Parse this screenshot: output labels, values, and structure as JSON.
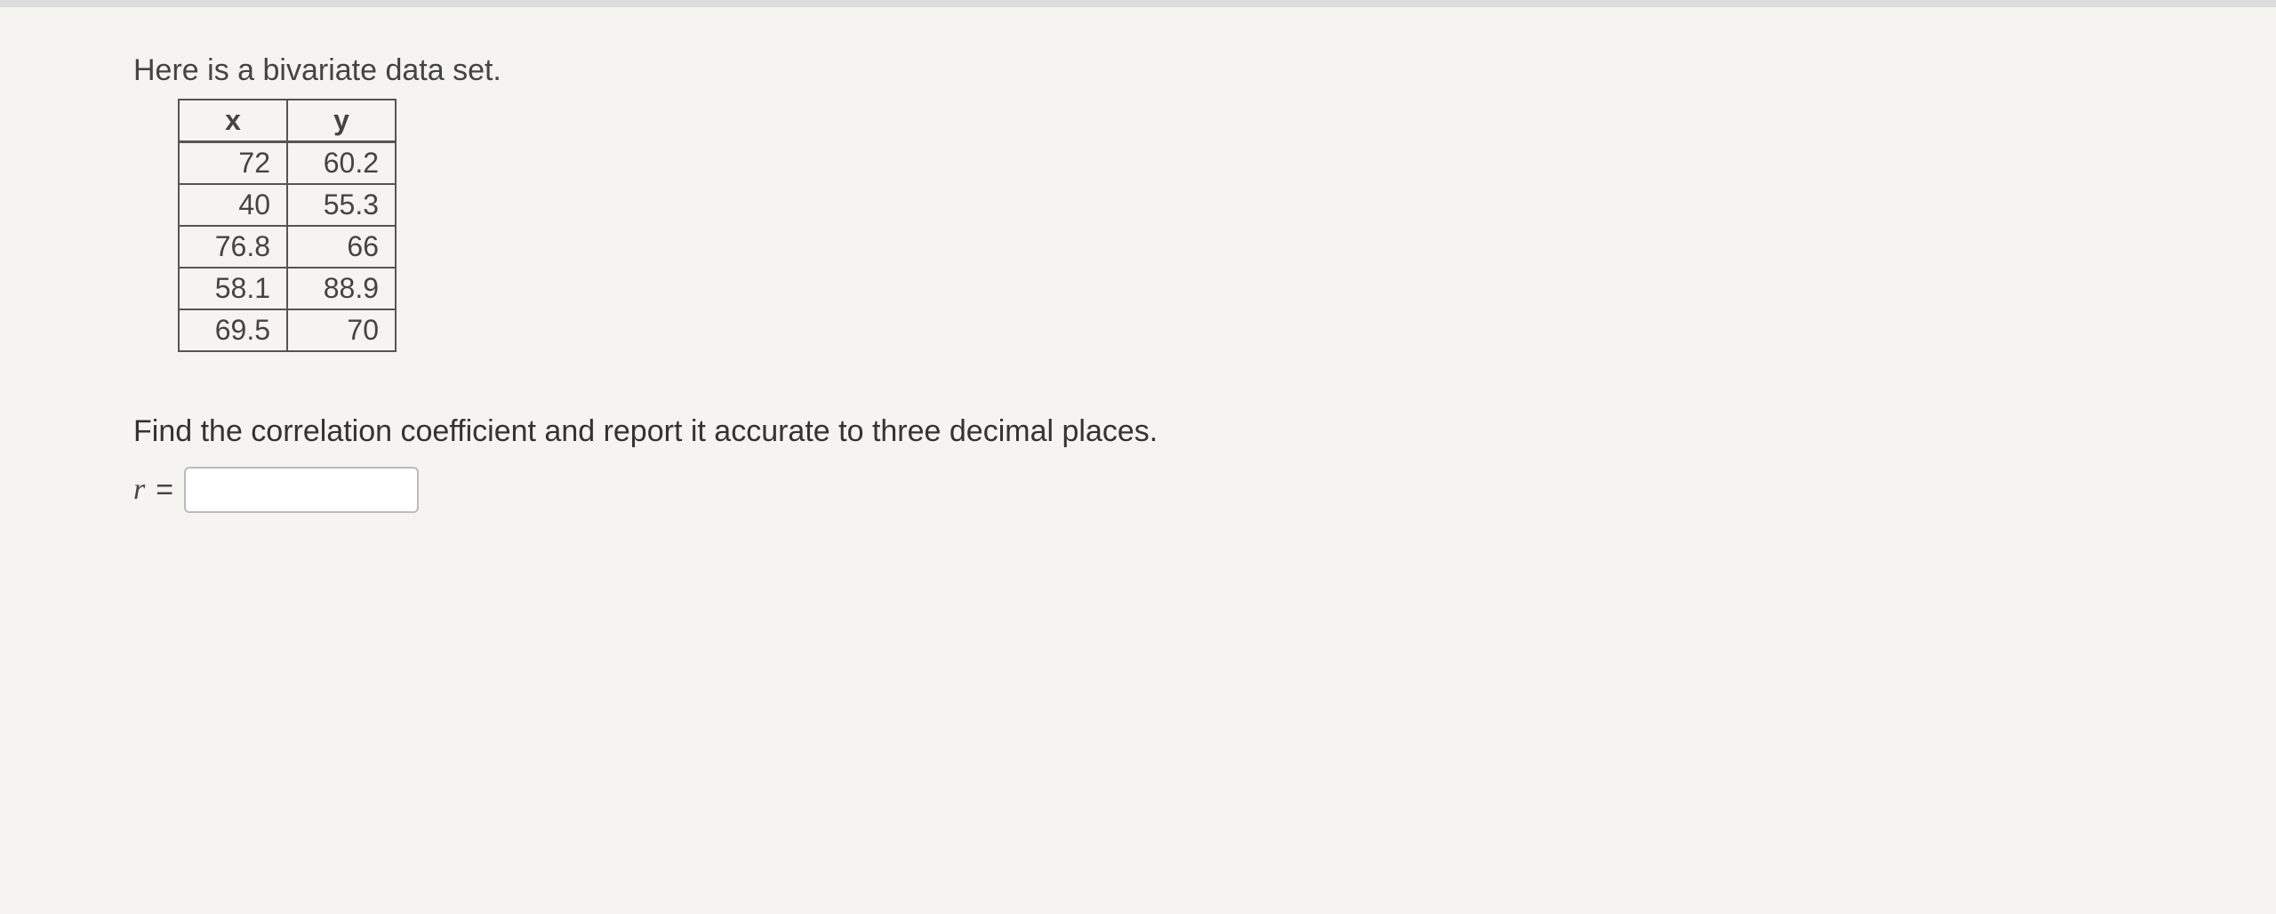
{
  "intro_text": "Here is a bivariate data set.",
  "headers": {
    "x": "x",
    "y": "y"
  },
  "rows": [
    {
      "x": "72",
      "y": "60.2"
    },
    {
      "x": "40",
      "y": "55.3"
    },
    {
      "x": "76.8",
      "y": "66"
    },
    {
      "x": "58.1",
      "y": "88.9"
    },
    {
      "x": "69.5",
      "y": "70"
    }
  ],
  "question_text": "Find the correlation coefficient and report it accurate to three decimal places.",
  "r_label": "r",
  "equals": "=",
  "answer_value": ""
}
